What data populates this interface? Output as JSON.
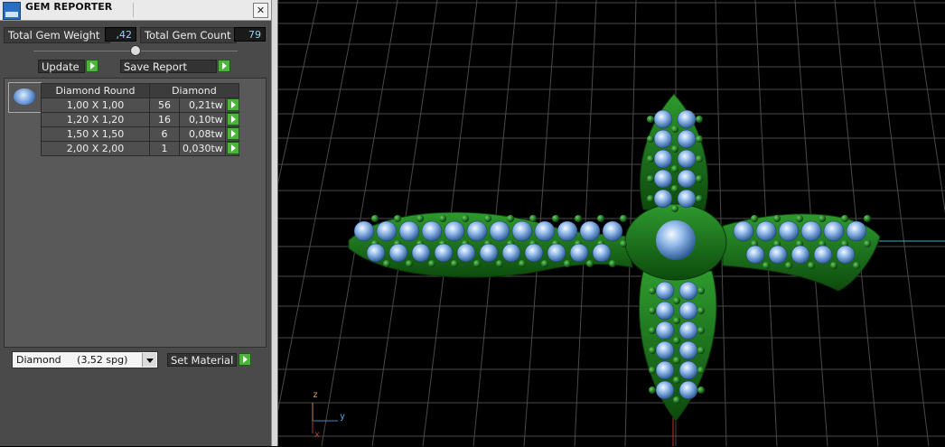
{
  "window": {
    "title": "GEM REPORTER",
    "close_glyph": "✕"
  },
  "stats": {
    "total_gem_weight_label": "Total Gem Weight",
    "total_gem_weight_value": ",42",
    "total_gem_count_label": "Total Gem Count",
    "total_gem_count_value": "79"
  },
  "buttons": {
    "update": "Update",
    "save_report": "Save Report",
    "set_material": "Set Material"
  },
  "table": {
    "headers": [
      "Diamond Round",
      "Diamond"
    ],
    "rows": [
      {
        "size": "1,00 X 1,00",
        "count": "56",
        "tw": "0,21tw"
      },
      {
        "size": "1,20 X 1,20",
        "count": "16",
        "tw": "0,10tw"
      },
      {
        "size": "1,50 X 1,50",
        "count": "6",
        "tw": "0,08tw"
      },
      {
        "size": "2,00 X 2,00",
        "count": "1",
        "tw": "0,030tw"
      }
    ]
  },
  "material": {
    "selected": "Diamond     (3,52 spg)"
  },
  "axes": {
    "z": "z",
    "y": "y",
    "x": "x"
  },
  "colors": {
    "metal": "#1f7a1f",
    "gem": "#8fb8e8",
    "grid": "#4a4a4a",
    "accent_button": "#4bb53a"
  }
}
